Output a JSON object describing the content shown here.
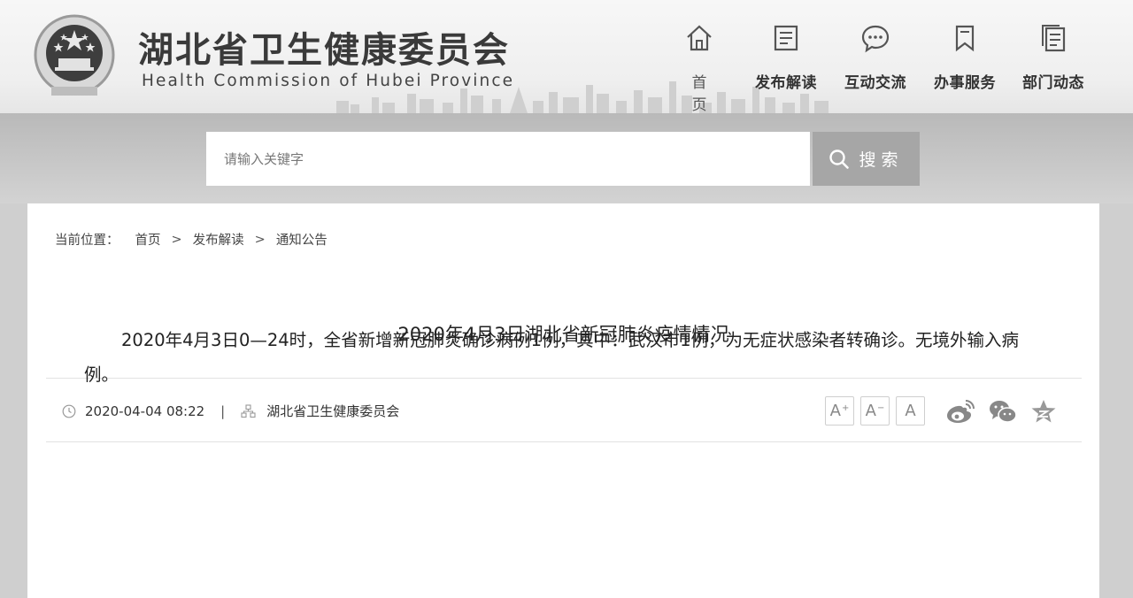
{
  "header": {
    "title": "湖北省卫生健康委员会",
    "subtitle": "Health Commission of Hubei Province",
    "nav": [
      {
        "label": "首　页",
        "icon": "home-icon"
      },
      {
        "label": "发布解读",
        "icon": "document-icon"
      },
      {
        "label": "互动交流",
        "icon": "chat-bubble-icon"
      },
      {
        "label": "办事服务",
        "icon": "bookmark-icon"
      },
      {
        "label": "部门动态",
        "icon": "copy-document-icon"
      }
    ]
  },
  "search": {
    "placeholder": "请输入关键字",
    "button_label": "搜索"
  },
  "breadcrumb": {
    "label": "当前位置：",
    "items": [
      "首页",
      "发布解读",
      "通知公告"
    ],
    "separator": ">"
  },
  "article": {
    "title": "2020年4月3日湖北省新冠肺炎疫情情况",
    "date": "2020-04-04 08:22",
    "divider": "|",
    "source": "湖北省卫生健康委员会",
    "font_buttons": [
      "A+",
      "A-",
      "A"
    ],
    "share": [
      "weibo-icon",
      "wechat-icon",
      "qzone-icon"
    ],
    "body": [
      "2020年4月3日0—24时，全省新增新冠肺炎确诊病例1例，其中：武汉市1例，为无症状感染者转确诊。无境外输入病例。"
    ]
  }
}
